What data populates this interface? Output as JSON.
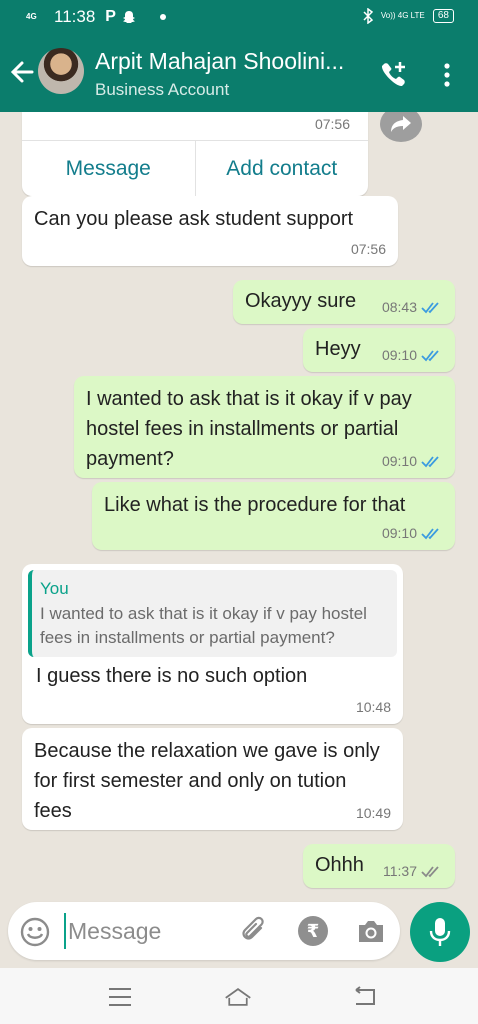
{
  "status_bar": {
    "network_left": "4G",
    "time": "11:38",
    "app_icon_letter": "P",
    "network_right": "Vo)) 4G LTE",
    "battery": "68"
  },
  "header": {
    "contact_name": "Arpit Mahajan Shoolini...",
    "subtitle": "Business Account"
  },
  "messages": [
    {
      "id": "card",
      "type": "incoming-card",
      "time": "07:56",
      "buttons": [
        "Message",
        "Add contact"
      ]
    },
    {
      "id": "m1",
      "type": "incoming",
      "text": "Can you please ask student support",
      "time": "07:56"
    },
    {
      "id": "m2",
      "type": "outgoing",
      "text": "Okayyy sure",
      "time": "08:43",
      "status": "read"
    },
    {
      "id": "m3",
      "type": "outgoing",
      "text": "Heyy",
      "time": "09:10",
      "status": "read"
    },
    {
      "id": "m4",
      "type": "outgoing",
      "text": "I wanted to ask that is it okay if v pay hostel fees in installments or partial payment?",
      "time": "09:10",
      "status": "read"
    },
    {
      "id": "m5",
      "type": "outgoing",
      "text": "Like what is the procedure for that",
      "time": "09:10",
      "status": "read"
    },
    {
      "id": "m6",
      "type": "incoming-reply",
      "quote_author": "You",
      "quote_text": "I wanted to ask that is it okay if v pay hostel fees in installments or partial payment?",
      "text": "I guess there is no such option",
      "time": "10:48"
    },
    {
      "id": "m7",
      "type": "incoming",
      "text": "Because the relaxation we gave is only for first semester and only on tution fees",
      "time": "10:49"
    },
    {
      "id": "m8",
      "type": "outgoing",
      "text": "Ohhh",
      "time": "11:37",
      "status": "delivered"
    }
  ],
  "composer": {
    "placeholder": "Message",
    "value": "",
    "rupee_symbol": "₹"
  },
  "colors": {
    "header": "#0b7d6c",
    "outgoing_bubble": "#dcf8c6",
    "incoming_bubble": "#ffffff",
    "accent": "#0aa28a",
    "read_ticks": "#3b9be0"
  },
  "icons": [
    "back-arrow-icon",
    "call-add-icon",
    "menu-dots-icon",
    "forward-icon",
    "emoji-icon",
    "attach-icon",
    "rupee-icon",
    "camera-icon",
    "mic-icon",
    "nav-menu-icon",
    "nav-home-icon",
    "nav-back-icon"
  ]
}
